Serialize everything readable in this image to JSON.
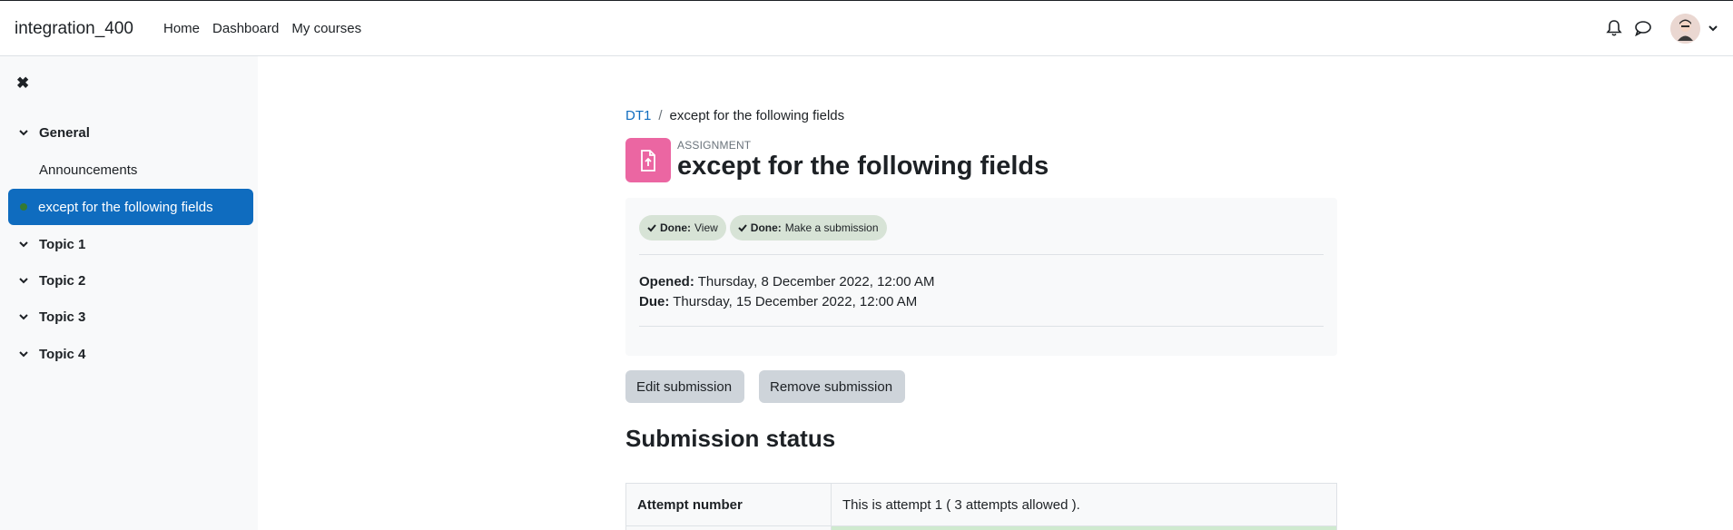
{
  "navbar": {
    "brand": "integration_400",
    "links": [
      "Home",
      "Dashboard",
      "My courses"
    ]
  },
  "drawer": {
    "items": [
      {
        "label": "General",
        "type": "section"
      },
      {
        "label": "Announcements",
        "type": "activity"
      },
      {
        "label": "except for the following fields",
        "type": "activity-active"
      },
      {
        "label": "Topic 1",
        "type": "section"
      },
      {
        "label": "Topic 2",
        "type": "section"
      },
      {
        "label": "Topic 3",
        "type": "section"
      },
      {
        "label": "Topic 4",
        "type": "section"
      }
    ]
  },
  "breadcrumb": {
    "course": "DT1",
    "separator": "/",
    "current": "except for the following fields"
  },
  "header": {
    "modname": "ASSIGNMENT",
    "title": "except for the following fields"
  },
  "completion": {
    "badges": [
      {
        "prefix": "Done:",
        "text": "View"
      },
      {
        "prefix": "Done:",
        "text": "Make a submission"
      }
    ]
  },
  "dates": {
    "opened_label": "Opened:",
    "opened_value": "Thursday, 8 December 2022, 12:00 AM",
    "due_label": "Due:",
    "due_value": "Thursday, 15 December 2022, 12:00 AM"
  },
  "actions": {
    "edit": "Edit submission",
    "remove": "Remove submission"
  },
  "submission": {
    "title": "Submission status",
    "attempt_label": "Attempt number",
    "attempt_value": "This is attempt 1 ( 3 attempts allowed )."
  },
  "colors": {
    "brand_blue": "#0f6cbf",
    "assign_pink": "#eb66a2",
    "done_badge": "#d7e3d6"
  }
}
